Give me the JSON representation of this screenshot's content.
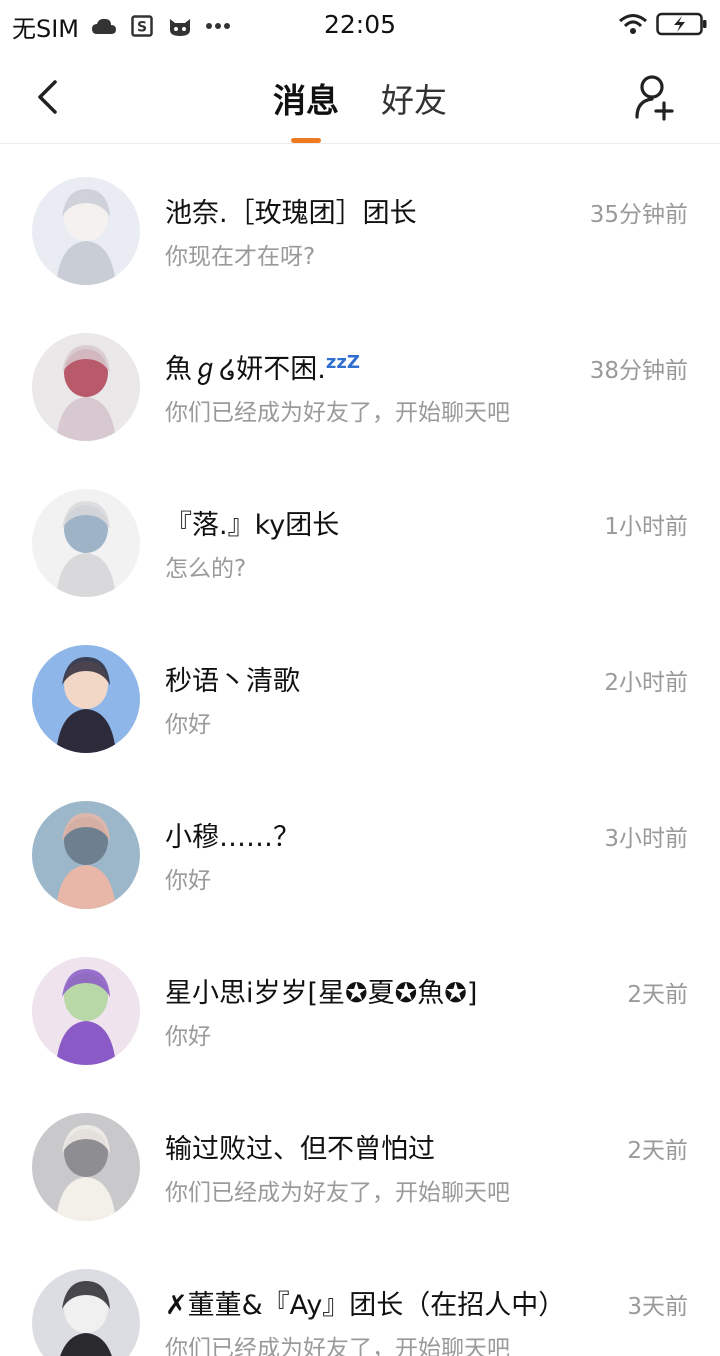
{
  "status_bar": {
    "carrier": "无SIM",
    "time": "22:05",
    "icons": [
      "cloud-icon",
      "s-badge-icon",
      "cat-face-icon",
      "more-dots-icon",
      "wifi-icon",
      "battery-charging-icon"
    ]
  },
  "nav": {
    "tabs": [
      {
        "label": "消息",
        "active": true
      },
      {
        "label": "好友",
        "active": false
      }
    ],
    "accent_color": "#f07a22"
  },
  "conversations": [
    {
      "name": "池奈.［玫瑰团］团长",
      "preview": "你现在才在呀?",
      "time": "35分钟前",
      "avatar_colors": [
        "#e9ecf2",
        "#c9cdd6",
        "#f4f1ee"
      ]
    },
    {
      "name": "魚ℊ໒妍不困.",
      "name_suffix": "zzZ",
      "preview": "你们已经成为好友了，开始聊天吧",
      "time": "38分钟前",
      "avatar_colors": [
        "#ebe8ea",
        "#d7c9cf",
        "#b85a6a"
      ]
    },
    {
      "name": "『落.』ky团长",
      "preview": "怎么的?",
      "time": "1小时前",
      "avatar_colors": [
        "#f2f2f2",
        "#d9d9dc",
        "#9fb3c7"
      ]
    },
    {
      "name": "秒语丶清歌",
      "preview": "你好",
      "time": "2小时前",
      "avatar_colors": [
        "#8fb6e8",
        "#2d2a3a",
        "#f3d7c6"
      ]
    },
    {
      "name": "小穆……？",
      "preview": "你好",
      "time": "3小时前",
      "avatar_colors": [
        "#9cb7c9",
        "#e8b7a7",
        "#6e7f8f"
      ]
    },
    {
      "name": "星小思i岁岁[星✪夏✪魚✪]",
      "preview": "你好",
      "time": "2天前",
      "avatar_colors": [
        "#efe4ee",
        "#8a5bc7",
        "#b8d8a8"
      ]
    },
    {
      "name": "输过败过、但不曾怕过",
      "preview": "你们已经成为好友了，开始聊天吧",
      "time": "2天前",
      "avatar_colors": [
        "#c9c9cc",
        "#f3efe9",
        "#8e8e92"
      ]
    },
    {
      "name": "✗董董&『Ay』团长（在招人中）",
      "preview": "你们已经成为好友了，开始聊天吧",
      "time": "3天前",
      "avatar_colors": [
        "#dcdde2",
        "#2a2a2e",
        "#f0f0f0"
      ]
    }
  ]
}
